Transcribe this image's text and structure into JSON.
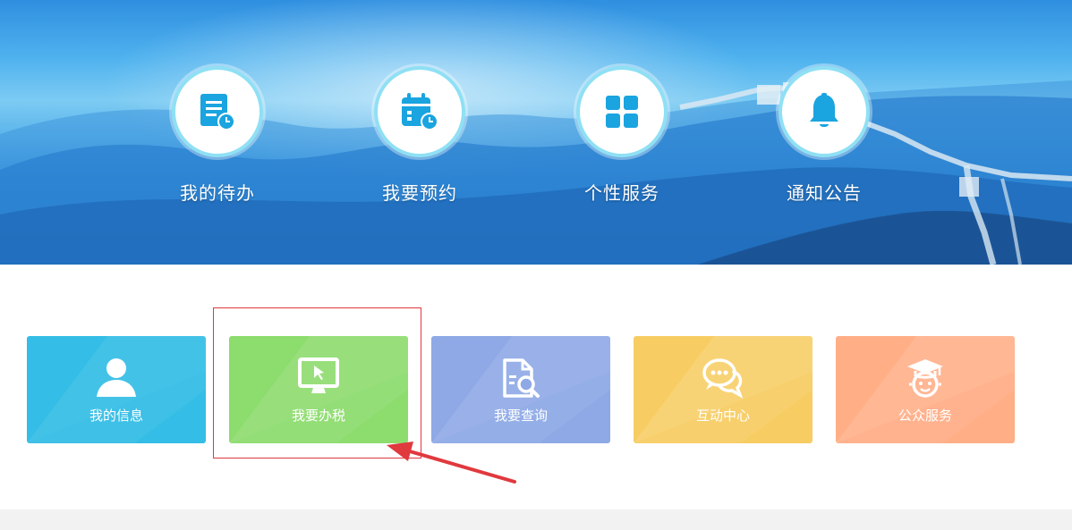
{
  "quick_links": [
    {
      "label": "我的待办",
      "icon": "todo-list-icon"
    },
    {
      "label": "我要预约",
      "icon": "calendar-clock-icon"
    },
    {
      "label": "个性服务",
      "icon": "grid-apps-icon"
    },
    {
      "label": "通知公告",
      "icon": "bell-icon"
    }
  ],
  "cards": [
    {
      "label": "我的信息",
      "icon": "user-icon",
      "color": "#34bde6"
    },
    {
      "label": "我要办税",
      "icon": "monitor-cursor-icon",
      "color": "#8ddc6e"
    },
    {
      "label": "我要查询",
      "icon": "document-search-icon",
      "color": "#8ea9e6"
    },
    {
      "label": "互动中心",
      "icon": "chat-bubbles-icon",
      "color": "#f7cd63"
    },
    {
      "label": "公众服务",
      "icon": "graduate-avatar-icon",
      "color": "#ffae86"
    }
  ],
  "colors": {
    "quick_icon": "#1aa4e0",
    "circle_border": "#8fe0f4",
    "highlight": "#e0393e"
  }
}
